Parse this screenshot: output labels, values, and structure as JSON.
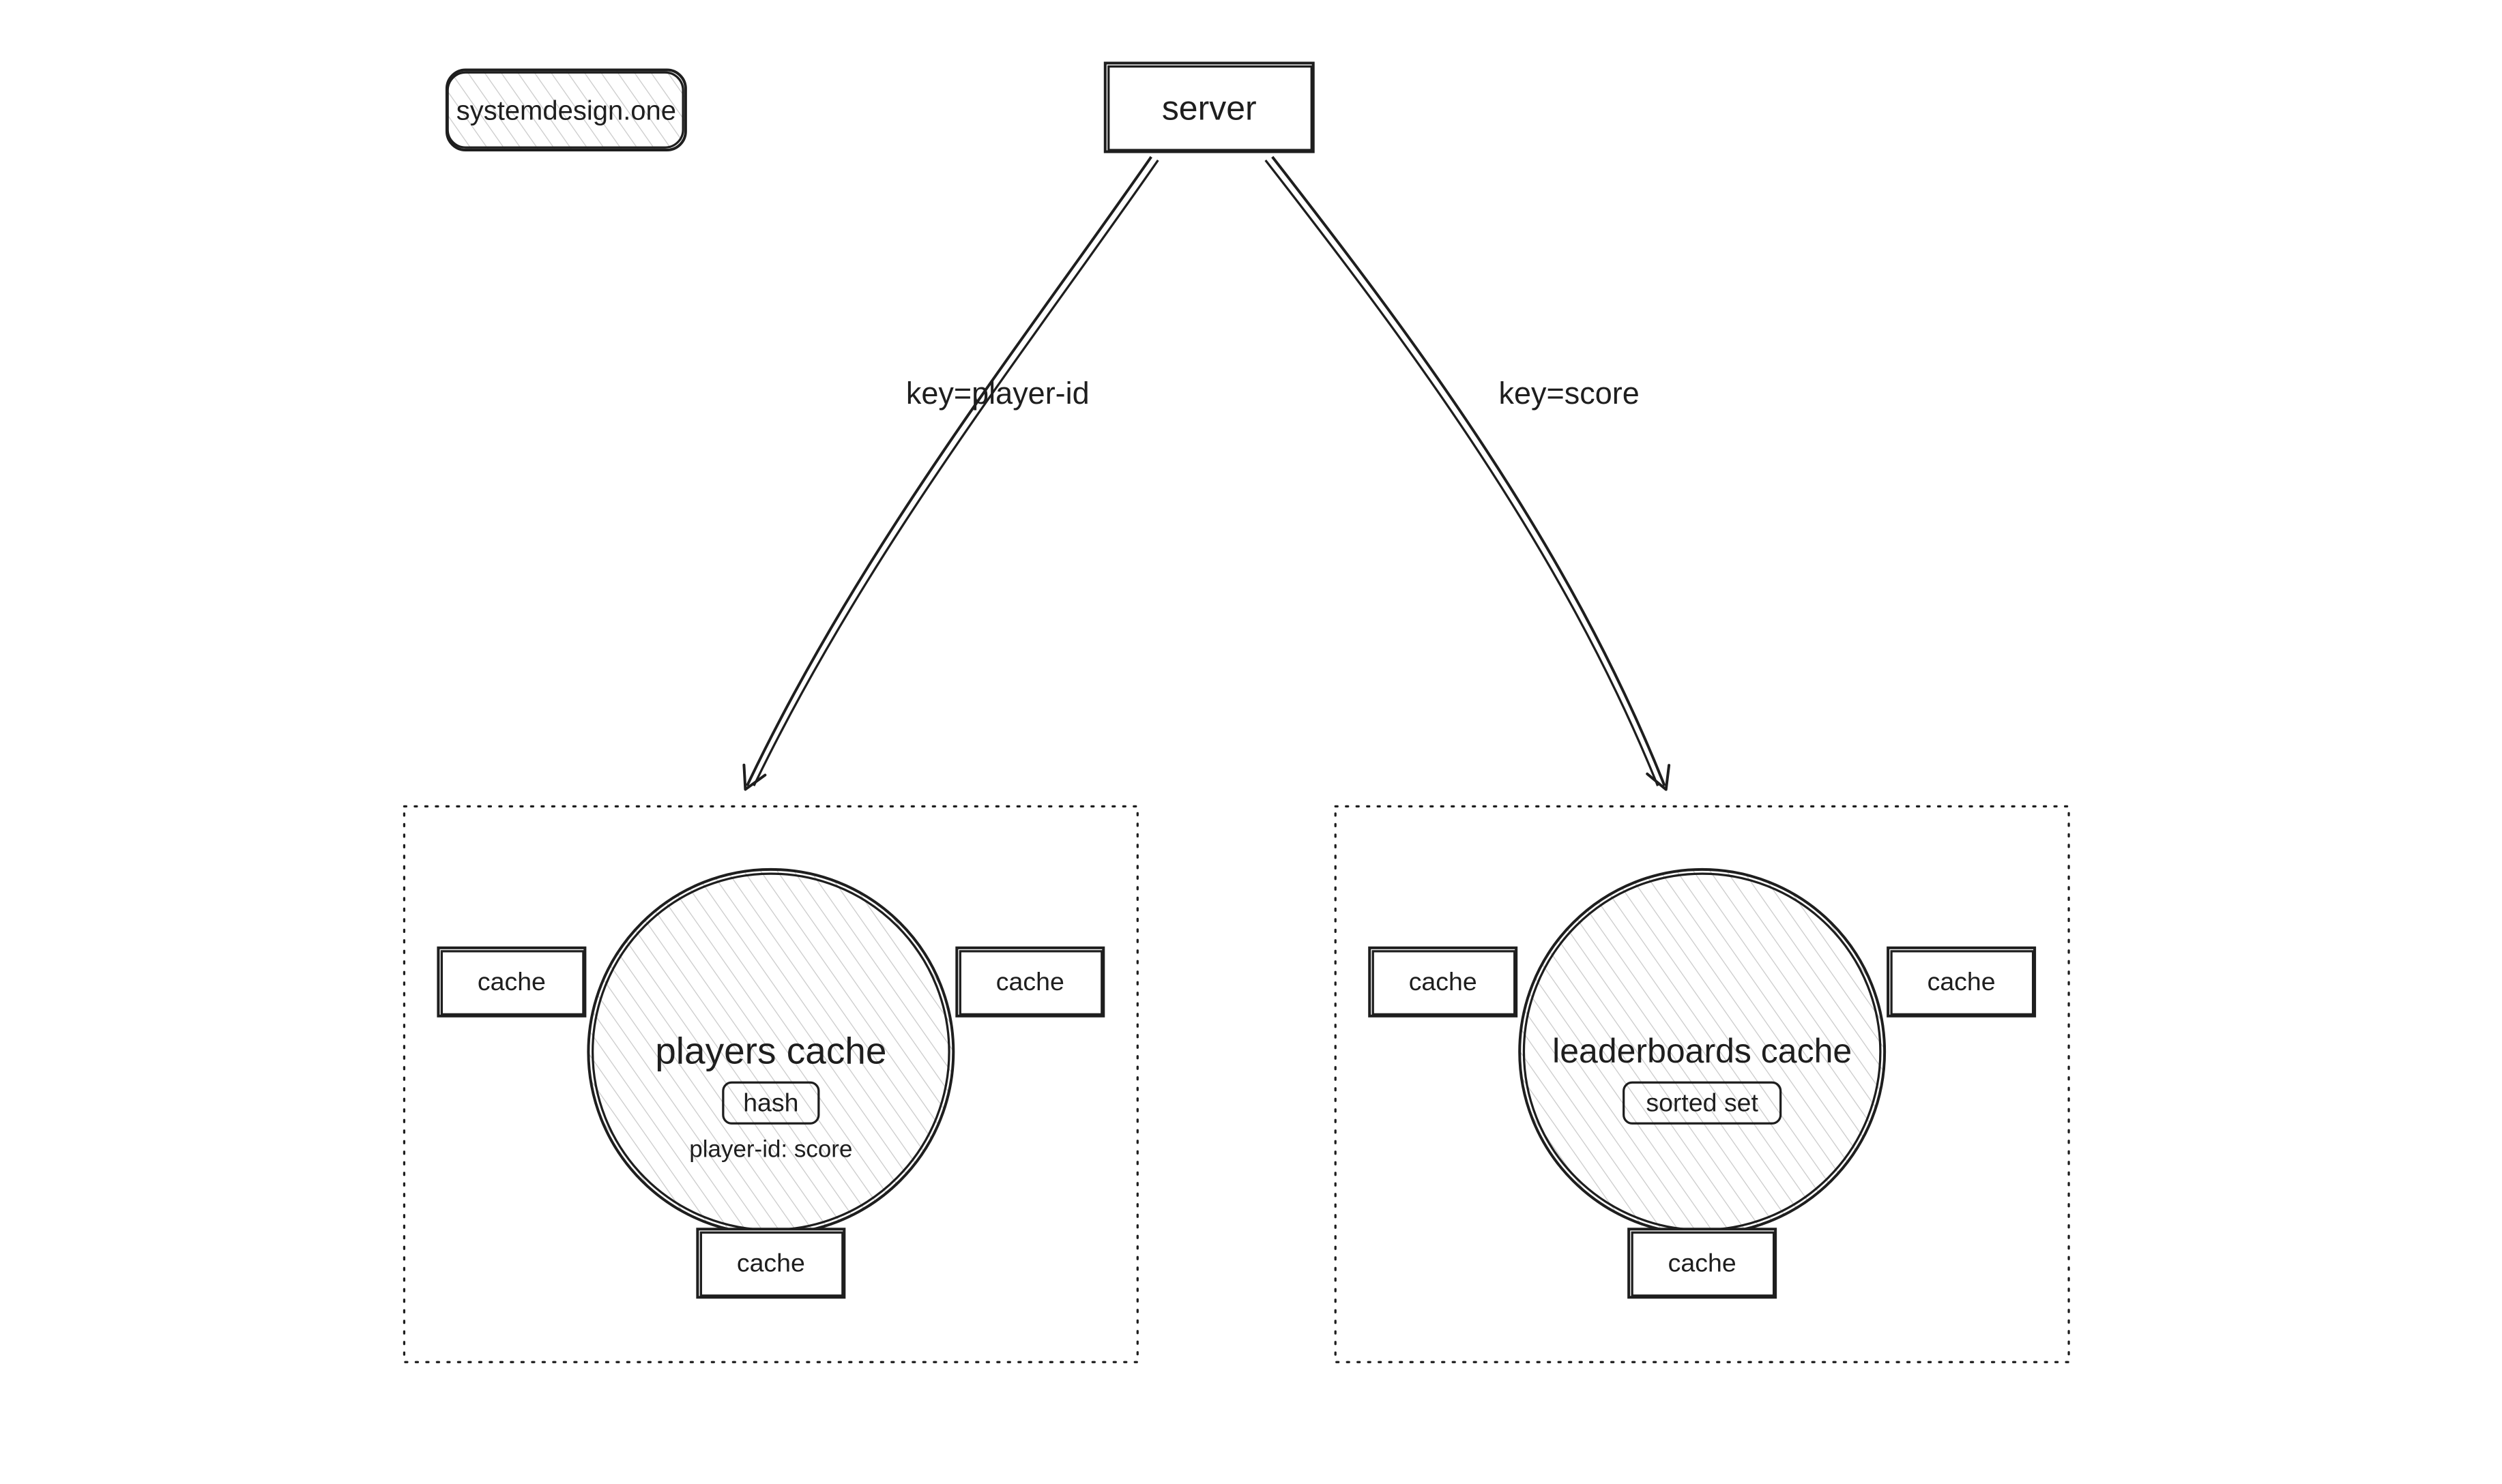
{
  "watermark": {
    "text": "systemdesign.one"
  },
  "server": {
    "label": "server"
  },
  "arrows": {
    "left_label": "key=player-id",
    "right_label": "key=score"
  },
  "left_cluster": {
    "title": "players cache",
    "badge": "hash",
    "subtitle": "player-id: score",
    "box_top_left": "cache",
    "box_top_right": "cache",
    "box_bottom": "cache"
  },
  "right_cluster": {
    "title": "leaderboards cache",
    "badge": "sorted set",
    "box_top_left": "cache",
    "box_top_right": "cache",
    "box_bottom": "cache"
  }
}
